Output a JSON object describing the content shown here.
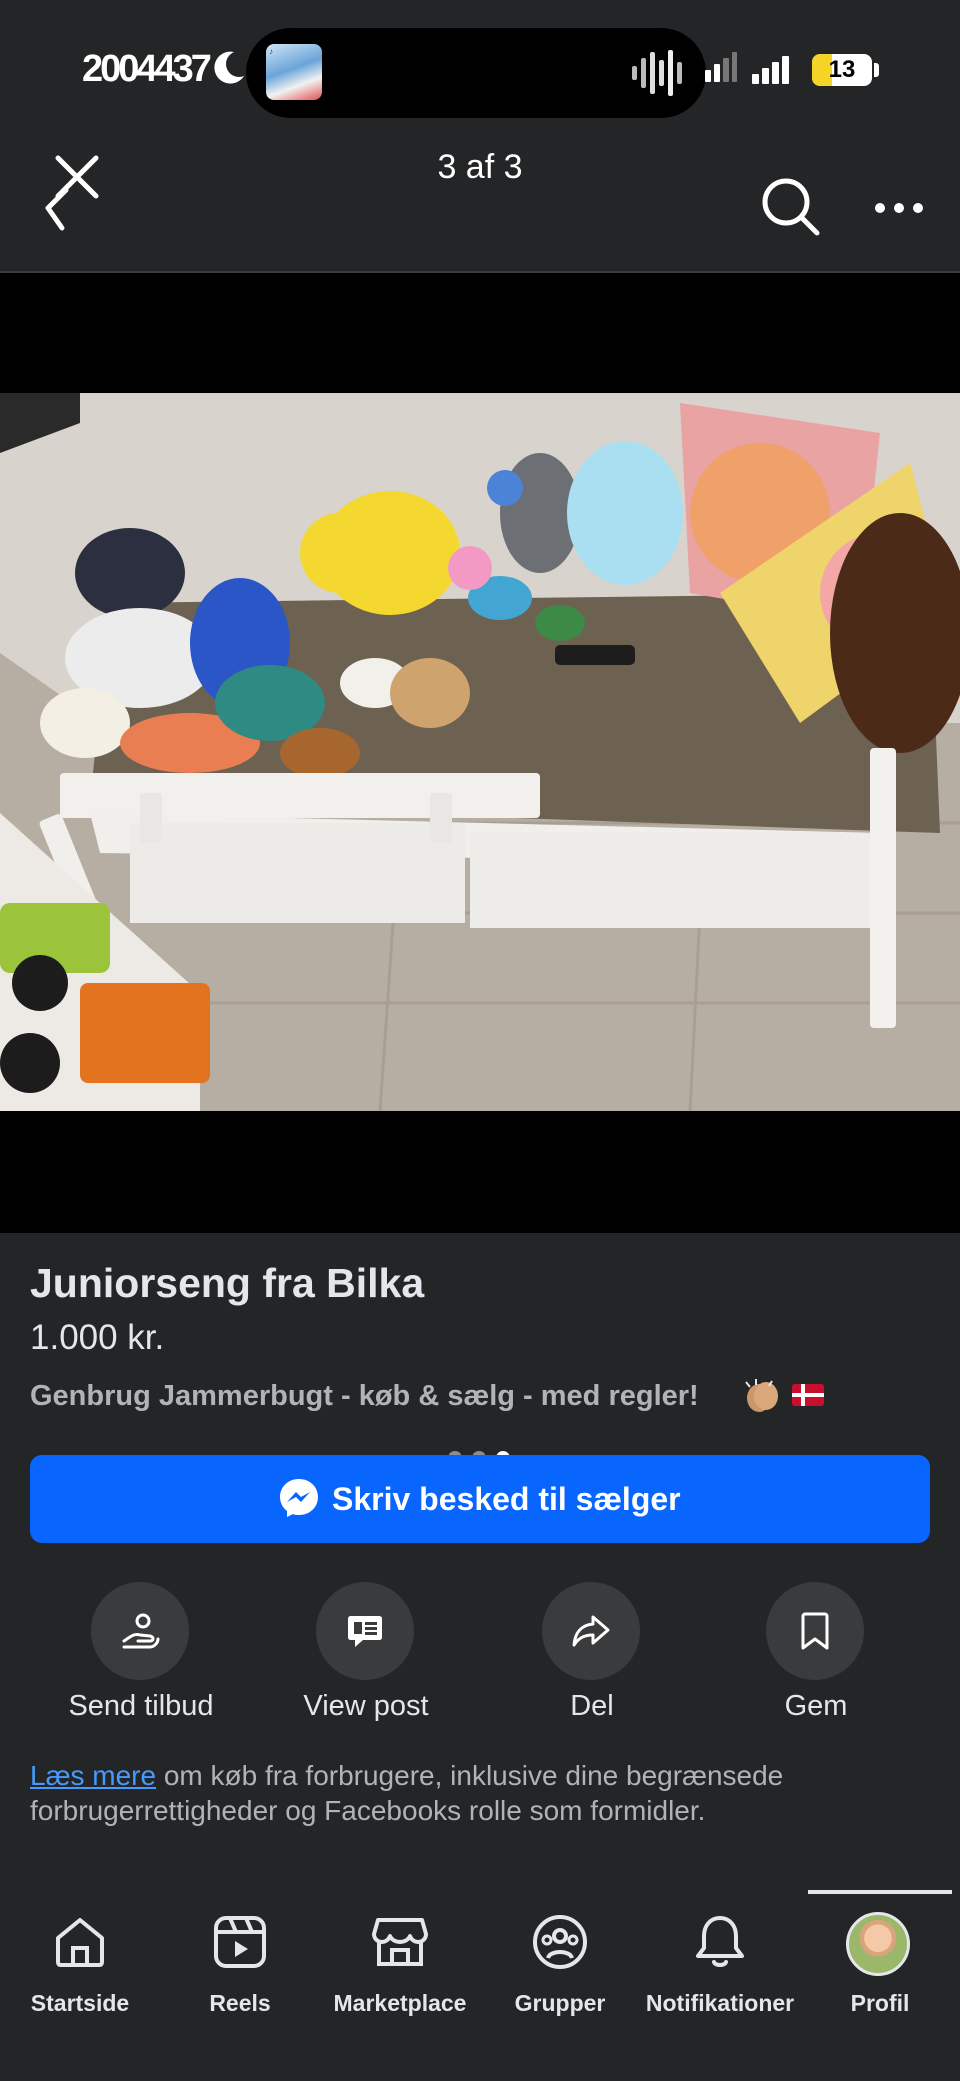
{
  "status_bar": {
    "time": "2004437",
    "battery": "13"
  },
  "header": {
    "title": "3 af 3"
  },
  "gallery": {
    "total_images": 3,
    "current_image": 3
  },
  "listing": {
    "title": "Juniorseng fra Bilka",
    "price": "1.000 kr.",
    "group": "Genbrug Jammerbugt - køb & sælg - med regler!",
    "message_button": "Skriv besked til sælger"
  },
  "actions": [
    {
      "label": "Send tilbud",
      "icon": "offer-icon"
    },
    {
      "label": "View post",
      "icon": "post-icon"
    },
    {
      "label": "Del",
      "icon": "share-icon"
    },
    {
      "label": "Gem",
      "icon": "bookmark-icon"
    }
  ],
  "disclaimer": {
    "link": "Læs mere",
    "text": " om køb fra forbrugere, inklusive dine begrænsede forbrugerrettigheder og Facebooks rolle som formidler."
  },
  "nav": [
    {
      "label": "Startside",
      "icon": "home-icon"
    },
    {
      "label": "Reels",
      "icon": "reels-icon"
    },
    {
      "label": "Marketplace",
      "icon": "marketplace-icon"
    },
    {
      "label": "Grupper",
      "icon": "groups-icon"
    },
    {
      "label": "Notifikationer",
      "icon": "bell-icon"
    },
    {
      "label": "Profil",
      "icon": "avatar",
      "active": true
    }
  ],
  "colors": {
    "background": "#242526",
    "accent": "#0866ff",
    "link": "#4599ff"
  }
}
